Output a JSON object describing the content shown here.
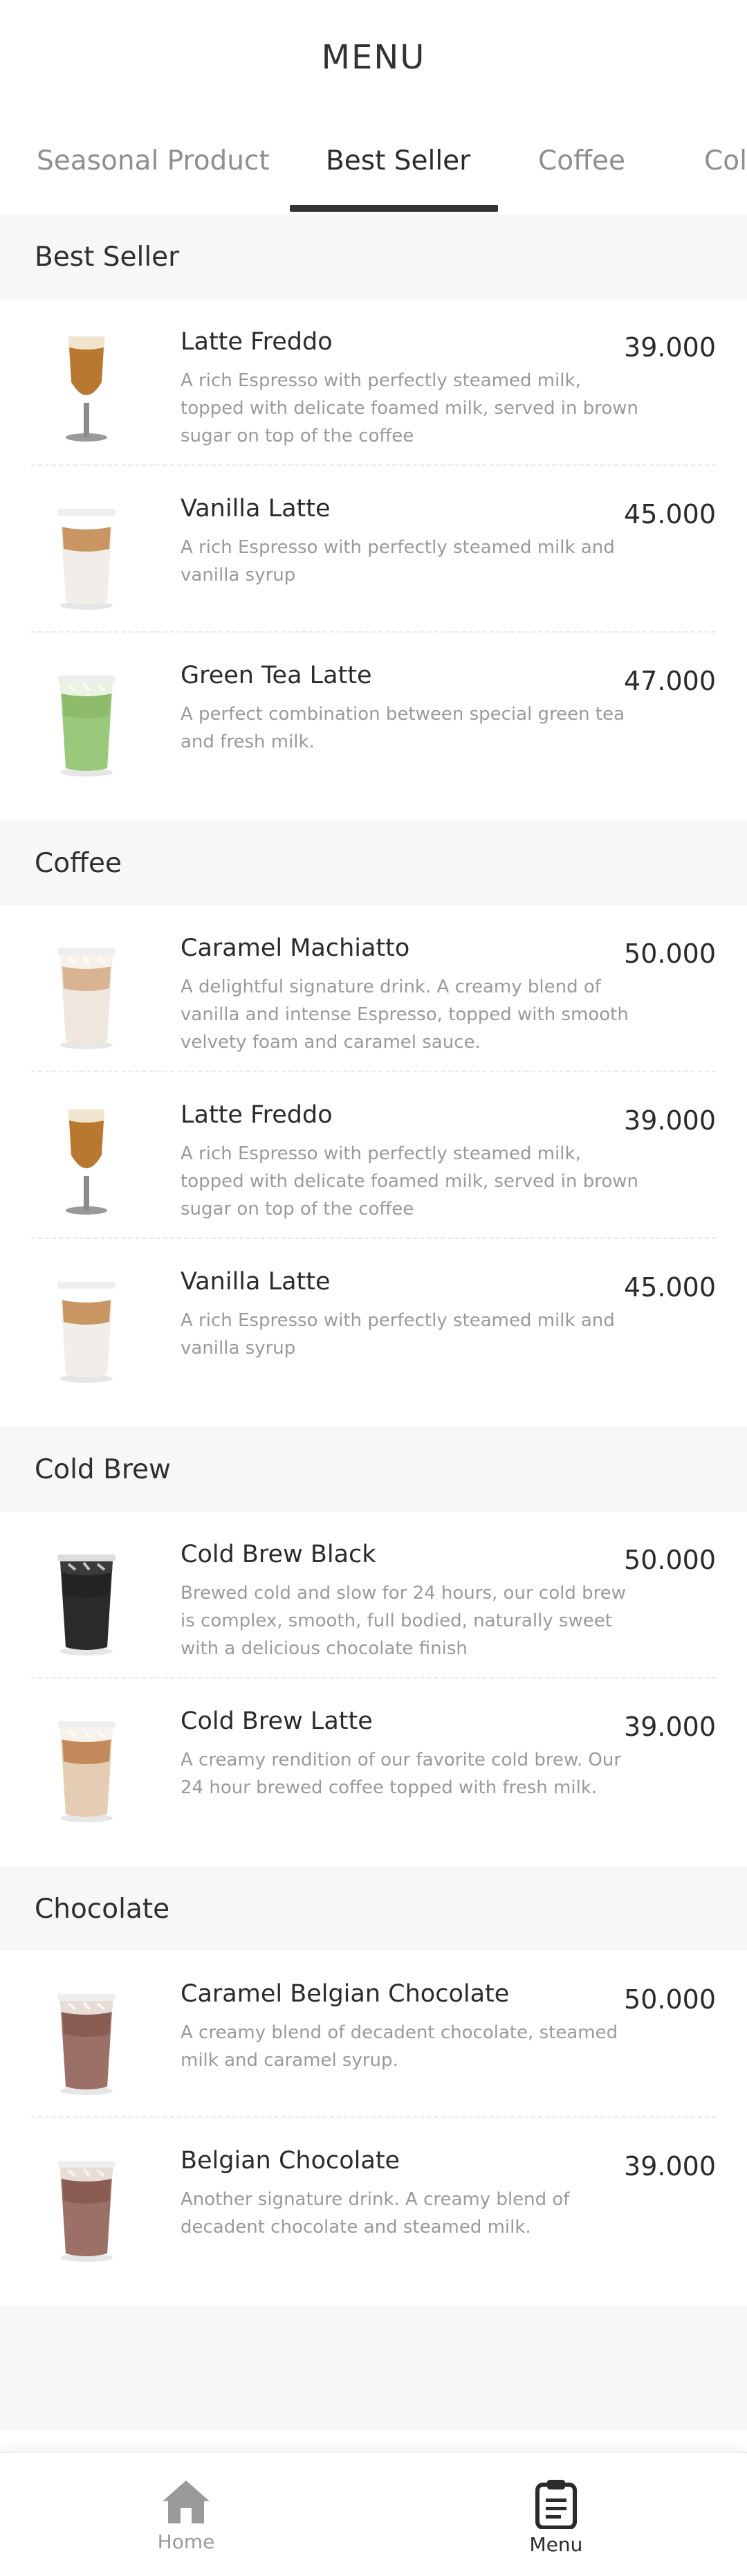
{
  "header": {
    "title": "MENU"
  },
  "tabs": [
    {
      "label": "Seasonal Product"
    },
    {
      "label": "Best Seller"
    },
    {
      "label": "Coffee"
    },
    {
      "label": "Col"
    }
  ],
  "sections": [
    {
      "title": "Best Seller",
      "items": [
        {
          "name": "Latte Freddo",
          "price": "39.000",
          "desc": "A rich Espresso with perfectly steamed milk, topped with delicate foamed milk, served in brown sugar on top of the coffee",
          "icon": "goblet-latte-icon"
        },
        {
          "name": "Vanilla Latte",
          "price": "45.000",
          "desc": "A rich Espresso with perfectly steamed milk and vanilla syrup",
          "icon": "iced-latte-icon"
        },
        {
          "name": "Green Tea Latte",
          "price": "47.000",
          "desc": "A perfect combination between  special green tea and fresh milk.",
          "icon": "green-tea-latte-icon"
        }
      ]
    },
    {
      "title": "Coffee",
      "items": [
        {
          "name": "Caramel Machiatto",
          "price": "50.000",
          "desc": "A delightful signature drink. A creamy blend of vanilla and intense Espresso, topped with smooth velvety foam and caramel sauce.",
          "icon": "caramel-macchiato-icon"
        },
        {
          "name": "Latte Freddo",
          "price": "39.000",
          "desc": "A rich Espresso with perfectly steamed milk, topped with delicate foamed milk, served in brown sugar on top of the coffee",
          "icon": "goblet-latte-icon"
        },
        {
          "name": "Vanilla Latte",
          "price": "45.000",
          "desc": "A rich Espresso with perfectly steamed milk and vanilla syrup",
          "icon": "iced-latte-icon"
        }
      ]
    },
    {
      "title": "Cold Brew",
      "items": [
        {
          "name": "Cold Brew Black",
          "price": "50.000",
          "desc": "Brewed cold and slow for 24 hours, our cold brew is complex, smooth, full bodied, naturally sweet with a delicious chocolate finish",
          "icon": "cold-brew-black-icon"
        },
        {
          "name": "Cold Brew Latte",
          "price": "39.000",
          "desc": "A creamy rendition of our favorite cold brew. Our 24 hour brewed coffee topped with fresh milk.",
          "icon": "cold-brew-latte-icon"
        }
      ]
    },
    {
      "title": "Chocolate",
      "items": [
        {
          "name": "Caramel Belgian Chocolate",
          "price": "50.000",
          "desc": "A creamy blend of decadent chocolate, steamed milk and caramel syrup.",
          "icon": "chocolate-drink-icon"
        },
        {
          "name": "Belgian Chocolate",
          "price": "39.000",
          "desc": "Another signature drink. A creamy blend of decadent chocolate and steamed milk.",
          "icon": "chocolate-drink-icon"
        }
      ]
    }
  ],
  "bottom_nav": {
    "home_label": "Home",
    "menu_label": "Menu",
    "home_icon": "home-icon",
    "menu_icon": "clipboard-icon"
  }
}
